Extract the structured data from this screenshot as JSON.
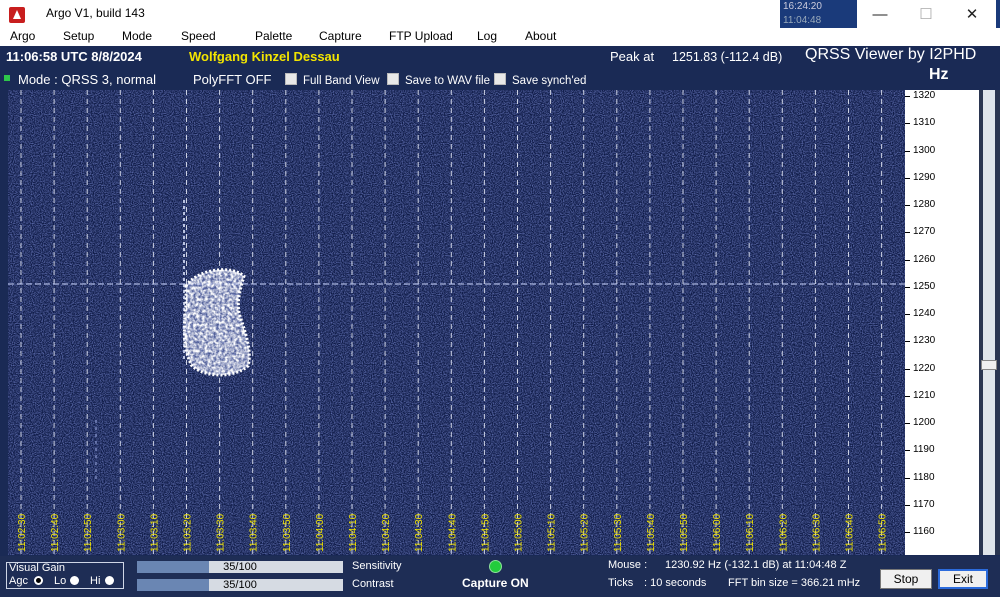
{
  "window": {
    "title": "Argo V1, build 143",
    "icon": "argo-sail-icon",
    "minimize": "—",
    "maximize": "☐",
    "close": "✕"
  },
  "background_window": {
    "time1": "16:24:20",
    "time2": "11:04:48"
  },
  "menu": [
    "Argo",
    "Setup",
    "Mode",
    "Speed",
    "Palette",
    "Capture",
    "FTP Upload",
    "Log",
    "About"
  ],
  "info": {
    "datetime": "11:06:58 UTC  8/8/2024",
    "station": "Wolfgang Kinzel Dessau",
    "peak_label": "Peak at",
    "peak_value": "1251.83 (-112.4 dB)",
    "app_name": "QRSS Viewer by I2PHD",
    "mode": "Mode : QRSS 3, normal",
    "polyfft": "PolyFFT OFF",
    "hz_unit": "Hz"
  },
  "options": [
    {
      "label": "Full Band View",
      "checked": false
    },
    {
      "label": "Save to WAV file",
      "checked": false
    },
    {
      "label": "Save synch'ed",
      "checked": false
    }
  ],
  "freq_ticks": [
    "1320",
    "1310",
    "1300",
    "1290",
    "1280",
    "1270",
    "1260",
    "1250",
    "1240",
    "1230",
    "1220",
    "1210",
    "1200",
    "1190",
    "1180",
    "1170",
    "1160"
  ],
  "time_ticks": [
    "11:02:30",
    "11:02:40",
    "11:02:50",
    "11:03:00",
    "11:03:10",
    "11:03:20",
    "11:03:30",
    "11:03:40",
    "11:03:50",
    "11:04:00",
    "11:04:10",
    "11:04:20",
    "11:04:30",
    "11:04:40",
    "11:04:50",
    "11:05:00",
    "11:05:10",
    "11:05:20",
    "11:05:30",
    "11:05:40",
    "11:05:50",
    "11:06:00",
    "11:06:10",
    "11:06:20",
    "11:06:30",
    "11:06:40",
    "11:06:50"
  ],
  "bottom": {
    "visual_gain": "Visual Gain",
    "agc": "Agc",
    "lo": "Lo",
    "hi": "Hi",
    "selected_gain": "Agc",
    "sensitivity_label": "Sensitivity",
    "sensitivity_value": "35/100",
    "sensitivity_fraction": 0.35,
    "contrast_label": "Contrast",
    "contrast_value": "35/100",
    "contrast_fraction": 0.35,
    "capture_status": "Capture ON",
    "mouse_label": "Mouse :",
    "mouse_value": "1230.92 Hz  (-132.1 dB) at 11:04:48 Z",
    "ticks_label": "Ticks",
    "ticks_value": ": 10 seconds",
    "fft_bin": "FFT bin size = 366.21 mHz",
    "stop": "Stop",
    "exit": "Exit"
  },
  "colors": {
    "waterfall_bg": "#0e1a46",
    "signal": "#ffffff",
    "accent_yellow": "#f3e500",
    "led_green": "#22cc3c"
  }
}
